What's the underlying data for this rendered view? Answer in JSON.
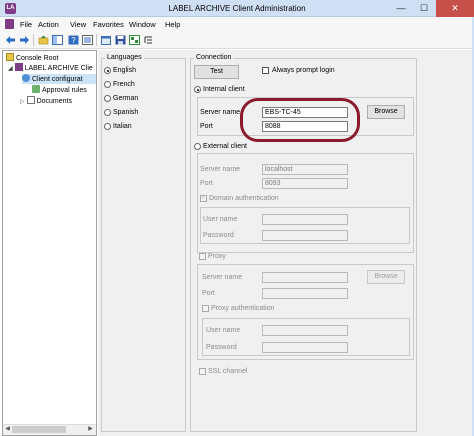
{
  "window": {
    "title": "LABEL ARCHIVE Client Administration",
    "app_icon_text": "LA",
    "min_glyph": "—",
    "max_glyph": "☐",
    "close_glyph": "✕"
  },
  "menu": {
    "file": "File",
    "action": "Action",
    "view": "View",
    "favorites": "Favorites",
    "window": "Window",
    "help": "Help"
  },
  "tree": {
    "root": "Console Root",
    "app": "LABEL ARCHIVE Clie",
    "client_config": "Client configurat",
    "approval_rules": "Approval rules",
    "documents": "Documents"
  },
  "languages": {
    "title": "Languages",
    "options": [
      "English",
      "French",
      "German",
      "Spanish",
      "Italian"
    ],
    "selected": "English"
  },
  "connection": {
    "title": "Connection",
    "test_button": "Test",
    "always_prompt_login": "Always prompt login",
    "internal_client": "Internal client",
    "internal": {
      "server_name_label": "Server name",
      "server_name_value": "EBS-TC-45",
      "port_label": "Port",
      "port_value": "8088",
      "browse_button": "Browse"
    },
    "external_client": "External client",
    "external": {
      "server_name_label": "Server name",
      "server_name_value": "localhost",
      "port_label": "Port",
      "port_value": "8093",
      "domain_auth": "Domain authentication",
      "user_name_label": "User name",
      "password_label": "Password"
    },
    "proxy": {
      "label": "Proxy",
      "server_name_label": "Server name",
      "port_label": "Port",
      "browse_button": "Browse",
      "proxy_auth": "Proxy authentication",
      "user_name_label": "User name",
      "password_label": "Password"
    },
    "ssl_channel": "SSL channel"
  },
  "colors": {
    "highlight_oval": "#8a1a2c",
    "title_bar": "#cfe0f4",
    "close_button": "#c7504a"
  }
}
